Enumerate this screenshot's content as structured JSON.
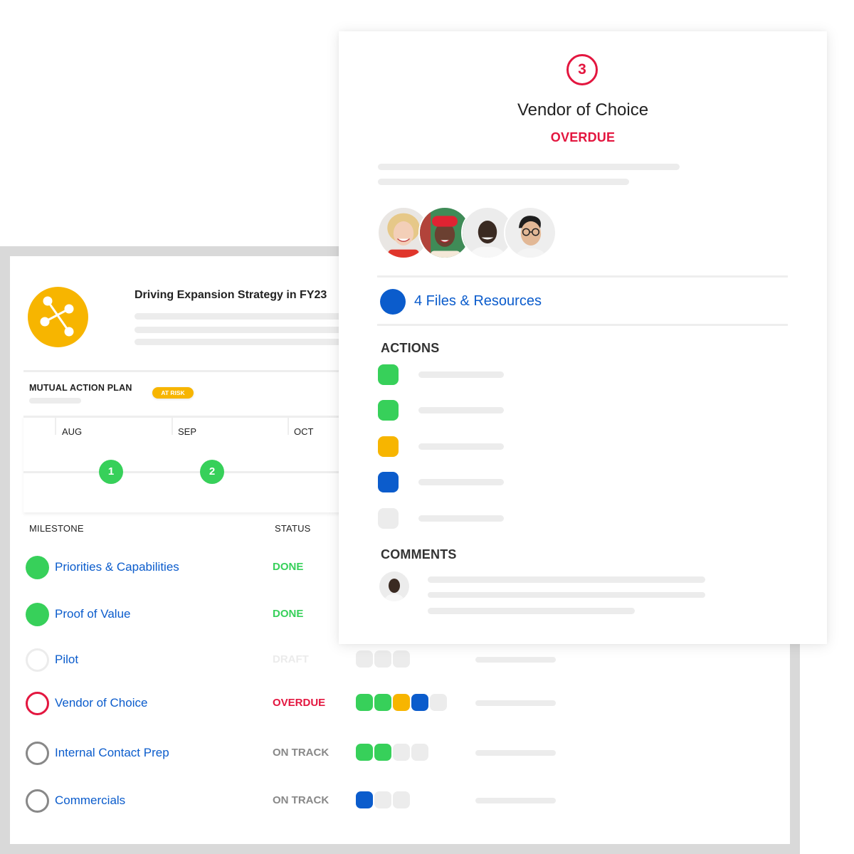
{
  "plan": {
    "title": "Driving Expansion Strategy in FY23",
    "logo_icon": "network-hub-icon",
    "section_label": "MUTUAL ACTION PLAN",
    "section_badge": "AT RISK",
    "timeline": {
      "months": [
        "AUG",
        "SEP",
        "OCT"
      ],
      "nodes": [
        {
          "label": "1",
          "status": "done"
        },
        {
          "label": "2",
          "status": "done"
        }
      ]
    },
    "columns": {
      "milestone": "MILESTONE",
      "status": "STATUS"
    },
    "milestones": [
      {
        "name": "Priorities & Capabilities",
        "status": "DONE",
        "state": "done",
        "progress": []
      },
      {
        "name": "Proof of Value",
        "status": "DONE",
        "state": "done",
        "progress": []
      },
      {
        "name": "Pilot",
        "status": "DRAFT",
        "state": "draft",
        "progress": [
          "empty",
          "empty",
          "empty"
        ]
      },
      {
        "name": "Vendor of Choice",
        "status": "OVERDUE",
        "state": "overdue",
        "progress": [
          "green",
          "green",
          "amber",
          "blue",
          "empty"
        ]
      },
      {
        "name": "Internal Contact Prep",
        "status": "ON TRACK",
        "state": "on-track",
        "progress": [
          "green",
          "green",
          "empty",
          "empty"
        ]
      },
      {
        "name": "Commercials",
        "status": "ON TRACK",
        "state": "on-track",
        "progress": [
          "blue",
          "empty",
          "empty"
        ]
      }
    ]
  },
  "detail": {
    "step_number": "3",
    "title": "Vendor of Choice",
    "status": "OVERDUE",
    "participants": [
      {
        "name": "participant-1"
      },
      {
        "name": "participant-2"
      },
      {
        "name": "participant-3"
      },
      {
        "name": "participant-4"
      }
    ],
    "files_link": "4 Files & Resources",
    "actions_heading": "ACTIONS",
    "actions": [
      {
        "state": "green"
      },
      {
        "state": "green"
      },
      {
        "state": "amber"
      },
      {
        "state": "blue"
      },
      {
        "state": "empty"
      }
    ],
    "comments_heading": "COMMENTS"
  },
  "colors": {
    "green": "#37d05a",
    "amber": "#f7b500",
    "blue": "#0b5ccc",
    "red": "#e3163f",
    "empty": "#ececec",
    "grey_text": "#888888",
    "draft_text": "#ebebeb"
  }
}
